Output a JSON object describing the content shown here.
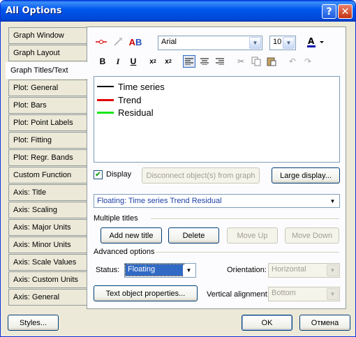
{
  "window": {
    "title": "All Options"
  },
  "tabs": [
    "Graph Window",
    "Graph Layout",
    "Graph Titles/Text",
    "Plot: General",
    "Plot: Bars",
    "Plot: Point Labels",
    "Plot: Fitting",
    "Plot: Regr. Bands",
    "Custom Function",
    "Axis: Title",
    "Axis: Scaling",
    "Axis: Major Units",
    "Axis: Minor Units",
    "Axis: Scale Values",
    "Axis: Custom Units",
    "Axis: General"
  ],
  "active_tab": "Graph Titles/Text",
  "toolbar": {
    "font_name": "Arial",
    "font_size": "10"
  },
  "text_lines": [
    {
      "label": "Time series",
      "color": "#000000"
    },
    {
      "label": "Trend",
      "color": "#e00000"
    },
    {
      "label": "Residual",
      "color": "#19e619"
    }
  ],
  "display_checkbox": {
    "label": "Display",
    "checked": true
  },
  "buttons": {
    "disconnect": "Disconnect object(s) from graph",
    "large_display": "Large display...",
    "add_new_title": "Add new title",
    "delete": "Delete",
    "move_up": "Move Up",
    "move_down": "Move Down",
    "text_object_properties": "Text object properties...",
    "styles": "Styles...",
    "ok": "OK",
    "cancel": "Отмена"
  },
  "titles_combo": {
    "value": "Floating:  Time series Trend Residual"
  },
  "groups": {
    "multiple_titles": "Multiple titles",
    "advanced_options": "Advanced options"
  },
  "status": {
    "label": "Status:",
    "value": "Floating"
  },
  "orientation": {
    "label": "Orientation:",
    "value": "Horizontal"
  },
  "vertical_alignment": {
    "label": "Vertical alignment:",
    "value": "Bottom"
  }
}
